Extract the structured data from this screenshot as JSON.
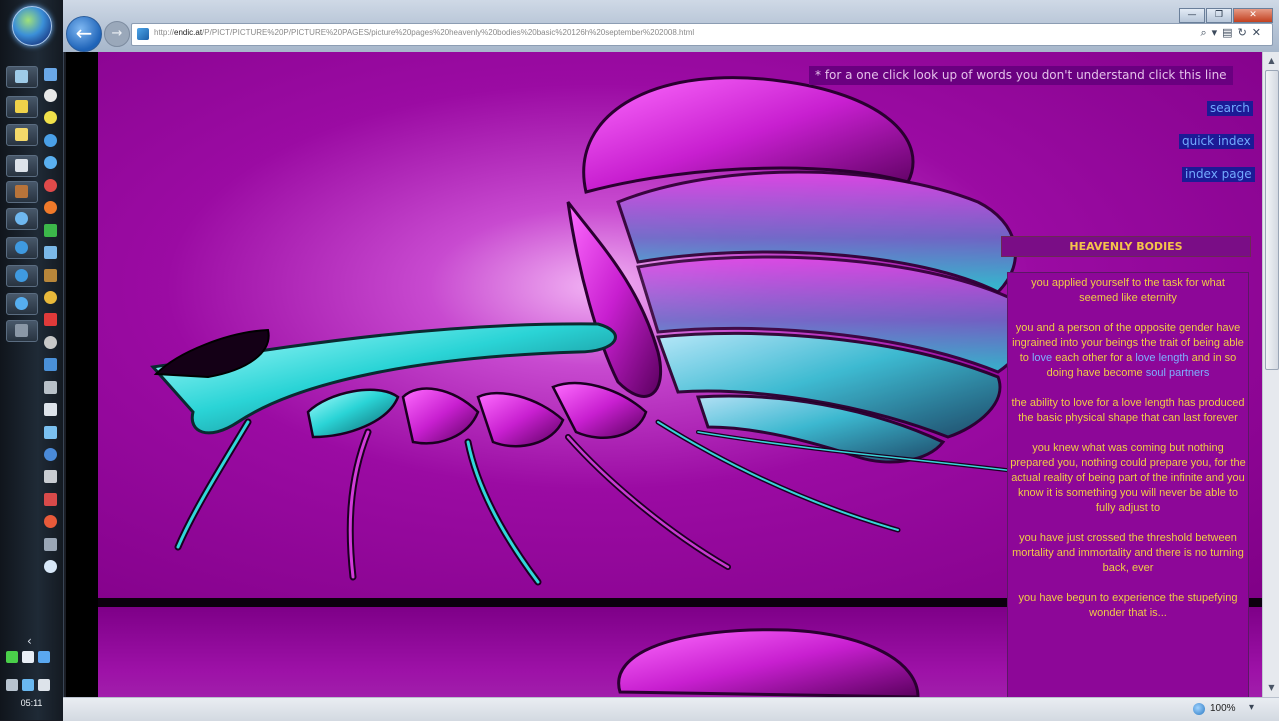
{
  "browser": {
    "url_prefix": "http://",
    "url_domain": "endic.at",
    "url_path": "/P/PICT/PICTURE%20P/PICTURE%20PAGES/picture%20pages%20heavenly%20bodies%20basic%20126h%20september%202008.html",
    "back_icon": "back-arrow-icon",
    "forward_icon": "forward-arrow-icon"
  },
  "page": {
    "lookup_banner": "* for a one click look up of words you don't understand click this line",
    "nav": {
      "search": "search",
      "quick_index": "quick index",
      "index_page": "index page"
    },
    "heading": "HEAVENLY BODIES",
    "paragraphs": {
      "p1": "you applied yourself to the task for what seemed like eternity",
      "p2_a": "you and a person of the opposite gender have ingrained into your beings the trait of being able to",
      "p2_love": "love",
      "p2_b": "each other for a",
      "p2_love_length": "love length",
      "p2_c": "and in so doing have become",
      "p2_soul_partners": "soul partners",
      "p3": "the ability to love for a love length has produced the basic physical shape that can last forever",
      "p4": "you knew what was coming but nothing prepared you, nothing could prepare you, for the actual reality of being part of the infinite and you know it is something you will never be able to fully adjust to",
      "p5": "you have just crossed the threshold between mortality and immortality and there is no turning back, ever",
      "p6": "you have begun to experience the stupefying wonder that is..."
    }
  },
  "status": {
    "zoom": "100%"
  },
  "taskbar": {
    "clock": "05:11"
  },
  "colors": {
    "art_magenta": "#9b0ba3",
    "text_gold": "#f0cc45",
    "link_blue": "#7eb1ff",
    "nav_bg": "#1c1a96"
  }
}
